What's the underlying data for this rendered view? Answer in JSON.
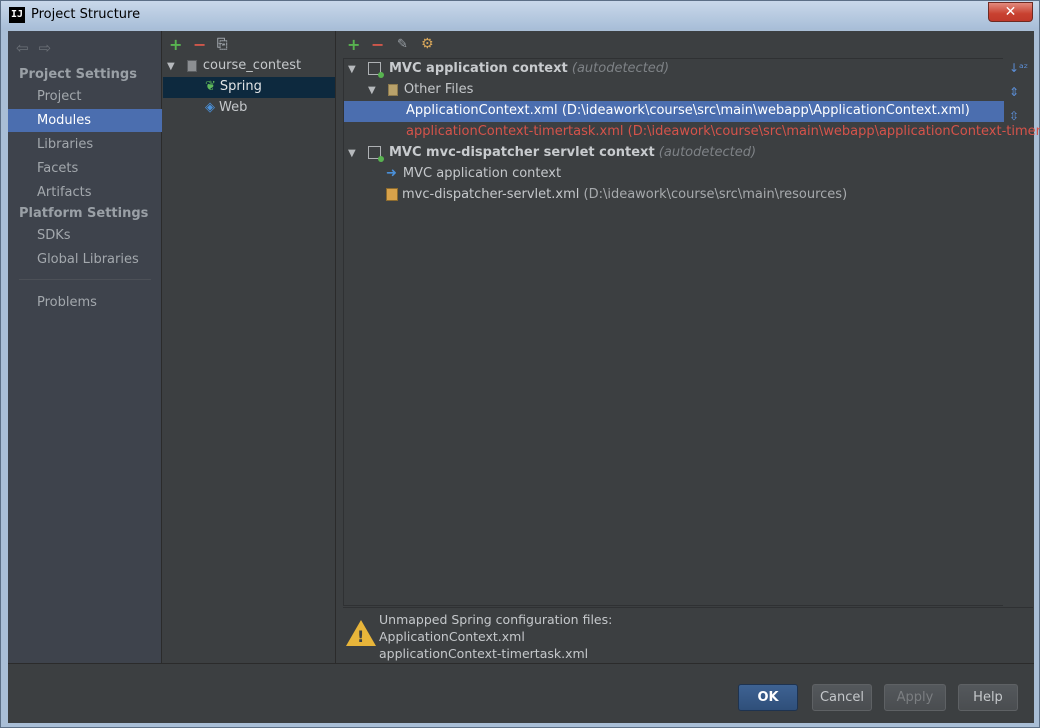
{
  "window": {
    "title": "Project Structure",
    "close_label": "✕"
  },
  "sidebar": {
    "project_settings": "Project Settings",
    "platform_settings": "Platform Settings",
    "items": [
      {
        "label": "Project"
      },
      {
        "label": "Modules",
        "selected": true
      },
      {
        "label": "Libraries"
      },
      {
        "label": "Facets"
      },
      {
        "label": "Artifacts"
      },
      {
        "label": "SDKs"
      },
      {
        "label": "Global Libraries"
      },
      {
        "label": "Problems"
      }
    ]
  },
  "modules_tree": {
    "root": "course_contest",
    "children": [
      "Spring",
      "Web"
    ]
  },
  "facet_tree": {
    "group1": {
      "label": "MVC application context",
      "tag": "(autodetected)"
    },
    "other_files": "Other Files",
    "file1": {
      "name": "ApplicationContext.xml",
      "path": "(D:\\ideawork\\course\\src\\main\\webapp\\ApplicationContext.xml)"
    },
    "file2": {
      "name": "applicationContext-timertask.xml",
      "path": "(D:\\ideawork\\course\\src\\main\\webapp\\applicationContext-timertask.:"
    },
    "group2": {
      "label": "MVC mvc-dispatcher servlet context",
      "tag": "(autodetected)"
    },
    "child1": "MVC application context",
    "child2": {
      "name": "mvc-dispatcher-servlet.xml",
      "path": "(D:\\ideawork\\course\\src\\main\\resources)"
    }
  },
  "warning": {
    "title": "Unmapped Spring configuration files:",
    "files": [
      "ApplicationContext.xml",
      "applicationContext-timertask.xml"
    ]
  },
  "buttons": {
    "ok": "OK",
    "cancel": "Cancel",
    "apply": "Apply",
    "help": "Help"
  },
  "colors": {
    "accent": "#4b6eaf",
    "selection_dark": "#0d293e",
    "error": "#d5534a",
    "warning": "#e8b53a"
  }
}
